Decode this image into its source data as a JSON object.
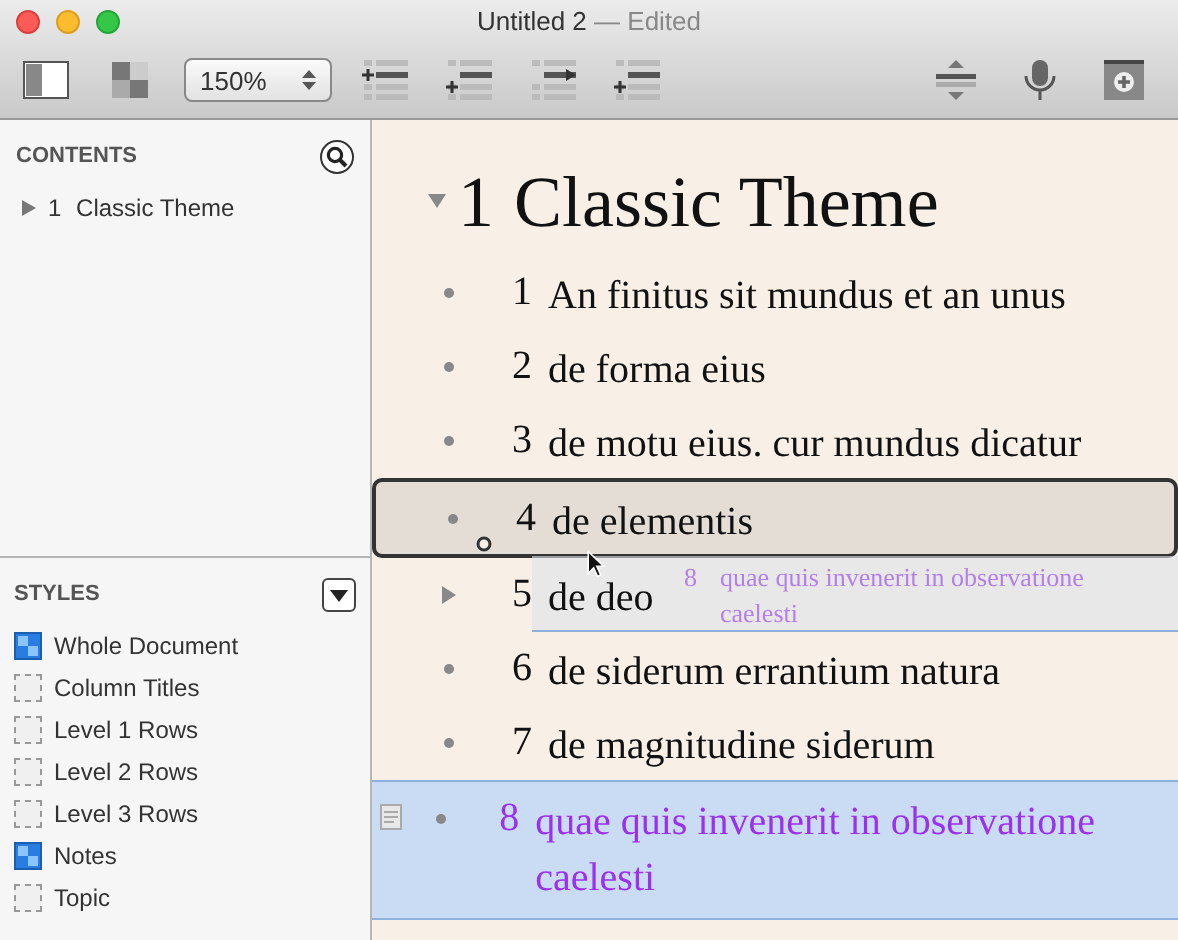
{
  "window": {
    "title": "Untitled 2",
    "status": "— Edited"
  },
  "toolbar": {
    "zoom": "150%"
  },
  "sidebar": {
    "contents_title": "CONTENTS",
    "contents": [
      {
        "number": "1",
        "label": "Classic Theme",
        "expanded": false
      }
    ],
    "styles_title": "STYLES",
    "styles": [
      {
        "label": "Whole Document",
        "applied": true
      },
      {
        "label": "Column Titles",
        "applied": false
      },
      {
        "label": "Level 1 Rows",
        "applied": false
      },
      {
        "label": "Level 2 Rows",
        "applied": false
      },
      {
        "label": "Level 3 Rows",
        "applied": false
      },
      {
        "label": "Notes",
        "applied": true
      },
      {
        "label": "Topic",
        "applied": false
      }
    ]
  },
  "outline": {
    "heading": {
      "number": "1",
      "text": "Classic Theme",
      "expanded": true
    },
    "rows": [
      {
        "number": "1",
        "text": "An finitus sit mundus et an unus",
        "collapsed": false,
        "focused": false,
        "selected": false,
        "has_note": false,
        "color": "#111111"
      },
      {
        "number": "2",
        "text": "de forma eius",
        "collapsed": false,
        "focused": false,
        "selected": false,
        "has_note": false,
        "color": "#111111"
      },
      {
        "number": "3",
        "text": "de motu eius. cur mundus dicatur",
        "collapsed": false,
        "focused": false,
        "selected": false,
        "has_note": false,
        "color": "#111111"
      },
      {
        "number": "4",
        "text": "de elementis",
        "collapsed": false,
        "focused": true,
        "selected": false,
        "has_note": false,
        "color": "#111111"
      },
      {
        "number": "5",
        "text": "de deo",
        "collapsed": true,
        "focused": false,
        "selected": false,
        "has_note": false,
        "color": "#111111"
      },
      {
        "number": "6",
        "text": "de siderum errantium natura",
        "collapsed": false,
        "focused": false,
        "selected": false,
        "has_note": false,
        "color": "#111111"
      },
      {
        "number": "7",
        "text": "de magnitudine siderum",
        "collapsed": false,
        "focused": false,
        "selected": false,
        "has_note": false,
        "color": "#111111"
      },
      {
        "number": "8",
        "text": "quae quis invenerit in observatione caelesti",
        "collapsed": false,
        "focused": false,
        "selected": true,
        "has_note": true,
        "color": "#9b30f0"
      }
    ],
    "drag_preview": {
      "number": "8",
      "text": "quae quis invenerit in observatione caelesti"
    }
  }
}
